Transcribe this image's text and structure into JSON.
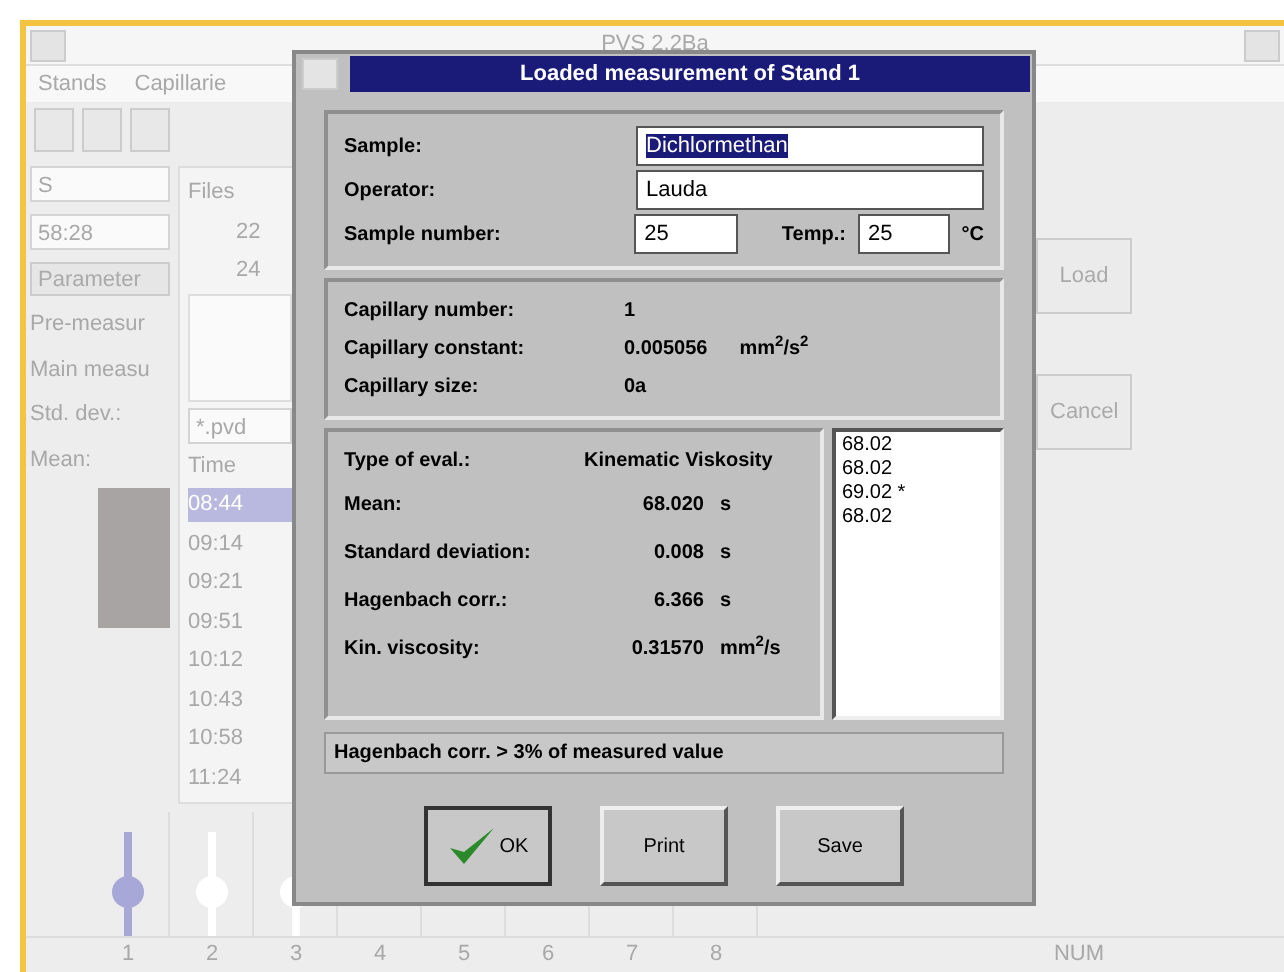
{
  "app": {
    "title": "PVS 2.2Ba",
    "menu": [
      "Stands",
      "Capillarie"
    ],
    "side": {
      "field": "S",
      "clock": "58:28",
      "button": "Parameter",
      "labels": [
        "Pre-measur",
        "Main measu",
        "Std. dev.:",
        "Mean:"
      ]
    },
    "files": {
      "heading": "Files",
      "items": [
        "22",
        "24"
      ],
      "filter": "*.pvd",
      "time_heading": "Time",
      "times": [
        {
          "text": "08:44",
          "selected": true
        },
        {
          "text": "09:14",
          "selected": false
        },
        {
          "text": "09:21",
          "selected": false
        },
        {
          "text": "09:51",
          "selected": false
        },
        {
          "text": "10:12",
          "selected": false
        },
        {
          "text": "10:43",
          "selected": false
        },
        {
          "text": "10:58",
          "selected": false
        },
        {
          "text": "11:24",
          "selected": false
        }
      ]
    },
    "buttons": [
      "Load",
      "Cancel"
    ],
    "stands": [
      {
        "label": "1",
        "color": "#a8a8d8"
      },
      {
        "label": "2",
        "color": "#ffffff"
      },
      {
        "label": "3",
        "color": "#ffffff"
      },
      {
        "label": "4"
      },
      {
        "label": "5"
      },
      {
        "label": "6"
      },
      {
        "label": "7"
      },
      {
        "label": "8"
      }
    ],
    "status": "NUM"
  },
  "dialog": {
    "title": "Loaded measurement of Stand 1",
    "sample": {
      "label": "Sample:",
      "value": "Dichlormethan"
    },
    "operator": {
      "label": "Operator:",
      "value": "Lauda"
    },
    "sample_number": {
      "label": "Sample number:",
      "value": "25"
    },
    "temp": {
      "label": "Temp.:",
      "value": "25",
      "unit": "°C"
    },
    "capillary": [
      {
        "label": "Capillary number:",
        "value": "1"
      },
      {
        "label": "Capillary constant:",
        "value": "0.005056",
        "unit": "mm$^{2}$/s$^{2}$"
      },
      {
        "label": "Capillary size:",
        "value": "0a"
      }
    ],
    "eval_type": {
      "label": "Type of eval.:",
      "value": "Kinematic Viskosity"
    },
    "results": [
      {
        "label": "Mean:",
        "value": "68.020",
        "unit": "s"
      },
      {
        "label": "Standard deviation:",
        "value": "0.008",
        "unit": "s"
      },
      {
        "label": "Hagenbach corr.:",
        "value": "6.366",
        "unit": "s"
      },
      {
        "label": "Kin. viscosity:",
        "value": "0.31570",
        "unit": "mm$^{2}$/s"
      }
    ],
    "readings": [
      "68.02",
      "68.02",
      "69.02 *",
      "68.02"
    ],
    "message": "Hagenbach corr. > 3% of measured value",
    "buttons": [
      "OK",
      "Print",
      "Save"
    ]
  }
}
